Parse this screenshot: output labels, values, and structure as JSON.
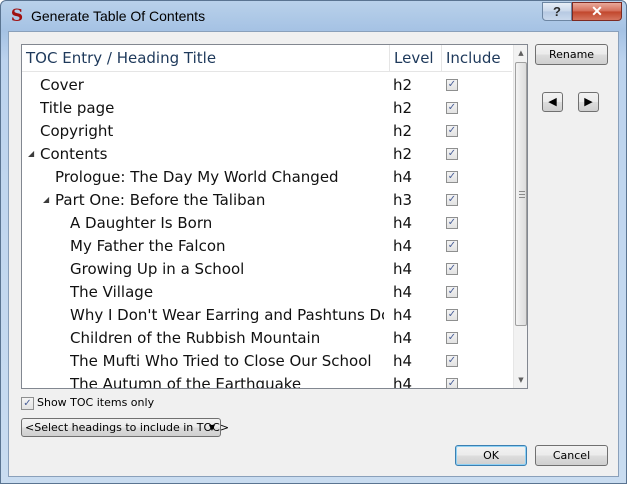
{
  "window": {
    "app_icon": "S",
    "title": "Generate Table Of Contents",
    "help_glyph": "?",
    "close_glyph": "✕"
  },
  "tree": {
    "columns": {
      "title": "TOC Entry / Heading Title",
      "level": "Level",
      "include": "Include"
    },
    "rows": [
      {
        "title": "Cover",
        "level": "h2",
        "include": true,
        "expander": "",
        "indent": 0
      },
      {
        "title": "Title page",
        "level": "h2",
        "include": true,
        "expander": "",
        "indent": 0
      },
      {
        "title": "Copyright",
        "level": "h2",
        "include": true,
        "expander": "",
        "indent": 0
      },
      {
        "title": "Contents",
        "level": "h2",
        "include": true,
        "expander": "◢",
        "indent": 0
      },
      {
        "title": "Prologue: The Day My World Changed",
        "level": "h4",
        "include": true,
        "expander": "",
        "indent": 1
      },
      {
        "title": "Part One: Before the Taliban",
        "level": "h3",
        "include": true,
        "expander": "◢",
        "indent": 1
      },
      {
        "title": "A Daughter Is Born",
        "level": "h4",
        "include": true,
        "expander": "",
        "indent": 2
      },
      {
        "title": "My Father the Falcon",
        "level": "h4",
        "include": true,
        "expander": "",
        "indent": 2
      },
      {
        "title": "Growing Up in a School",
        "level": "h4",
        "include": true,
        "expander": "",
        "indent": 2
      },
      {
        "title": "The Village",
        "level": "h4",
        "include": true,
        "expander": "",
        "indent": 2
      },
      {
        "title": "Why I Don't Wear Earring and Pashtuns Do...",
        "level": "h4",
        "include": true,
        "expander": "",
        "indent": 2
      },
      {
        "title": "Children of the Rubbish Mountain",
        "level": "h4",
        "include": true,
        "expander": "",
        "indent": 2
      },
      {
        "title": "The Mufti Who Tried to Close Our School",
        "level": "h4",
        "include": true,
        "expander": "",
        "indent": 2
      },
      {
        "title": "The Autumn of the Earthquake",
        "level": "h4",
        "include": true,
        "expander": "",
        "indent": 2
      }
    ]
  },
  "scrollbar": {
    "up": "▲",
    "down": "▼"
  },
  "buttons": {
    "rename": "Rename",
    "move_left": "◀",
    "move_right": "▶",
    "ok": "OK",
    "cancel": "Cancel"
  },
  "options": {
    "show_toc_only_label": "Show TOC items only",
    "show_toc_only_checked": true,
    "select_headings": "<Select headings to include in TOC>",
    "select_caret": "▼"
  },
  "check_glyph": "✓"
}
